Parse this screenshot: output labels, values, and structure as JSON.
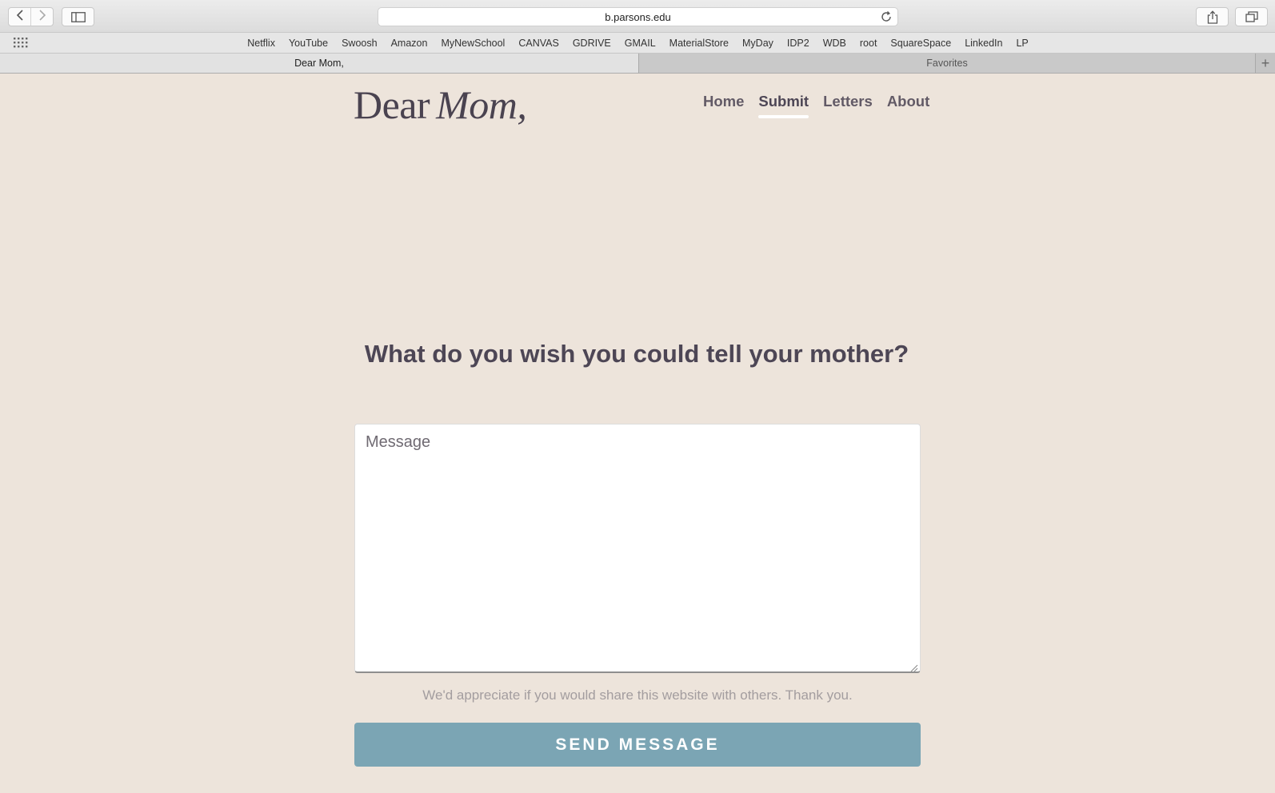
{
  "browser": {
    "url": "b.parsons.edu",
    "icons": {
      "back": "chevron-left-icon",
      "forward": "chevron-right-icon",
      "sidebar": "sidebar-icon",
      "reload": "reload-icon",
      "share": "share-icon",
      "tabs": "tabs-overview-icon",
      "grid": "grid-icon"
    },
    "favorites": [
      "Netflix",
      "YouTube",
      "Swoosh",
      "Amazon",
      "MyNewSchool",
      "CANVAS",
      "GDRIVE",
      "GMAIL",
      "MaterialStore",
      "MyDay",
      "IDP2",
      "WDB",
      "root",
      "SquareSpace",
      "LinkedIn",
      "LP"
    ],
    "tabs": {
      "active": "Dear Mom,",
      "inactive": "Favorites",
      "add": "+"
    }
  },
  "page": {
    "logo": {
      "plain": "Dear",
      "script": "Mom,"
    },
    "nav": [
      "Home",
      "Submit",
      "Letters",
      "About"
    ],
    "nav_active": "Submit",
    "question": "What do you wish you could tell your mother?",
    "message_placeholder": "Message",
    "message_value": "",
    "note": "We'd appreciate if you would share this website with others. Thank you.",
    "send_label": "SEND MESSAGE"
  },
  "colors": {
    "background": "#ede4db",
    "text": "#4d4655",
    "button": "#7ba5b4",
    "note": "#a39d9f"
  }
}
